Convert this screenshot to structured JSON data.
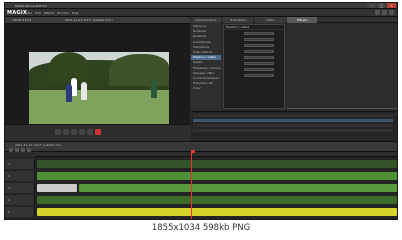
{
  "window": {
    "title": "MAGIX Movie Edit Pro",
    "project_tab": "2011-11-27 Ant F, publish.mm *"
  },
  "menubar": {
    "logo": "MAGIX",
    "items": [
      "File",
      "Edit",
      "Effects",
      "Window",
      "Help"
    ]
  },
  "viewer": {
    "timecode": "00:01:13:23",
    "project": "2011-11-27 Ant F, publish.mm *"
  },
  "effects": {
    "tabs": [
      "Import/export",
      "Transitions",
      "Titles",
      "Effects"
    ],
    "active_tab": "Effects",
    "list": [
      "Vibrance",
      "Gradient",
      "Gradient",
      "Look/Stylize",
      "Transitions",
      "Video effects",
      "Position / Cable",
      "Speed",
      "Travelling / Camera",
      "Sharpen / Blur",
      "Correction/Adjust",
      "Transition 3D",
      "Color"
    ],
    "selected_item": "Position / Cable",
    "panel_title": "Position / Cable"
  },
  "timeline": {
    "project": "2011-11-27 Ant F, publish.mm",
    "tracks": [
      "1",
      "2",
      "3",
      "4",
      "5"
    ]
  },
  "colors": {
    "accent": "#4b6b8a",
    "clip_green": "#4f8f37",
    "clip_yellow": "#d6d32a",
    "playhead": "#e33333"
  },
  "caption": "1855x1034 598kb PNG"
}
